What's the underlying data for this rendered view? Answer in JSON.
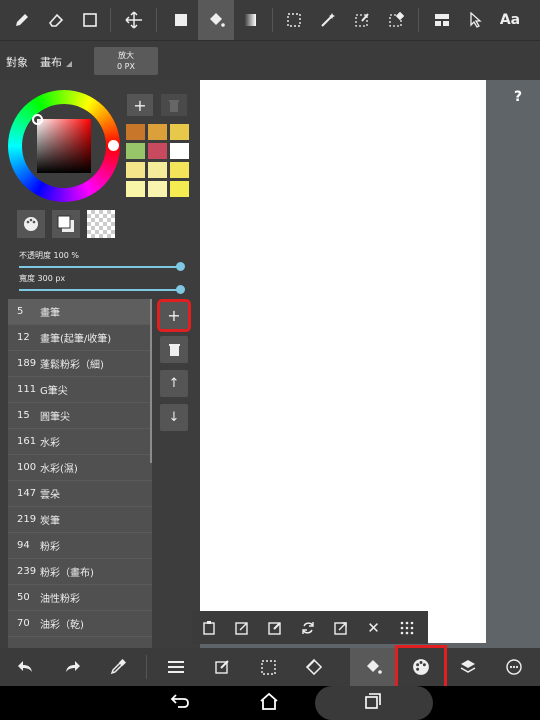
{
  "toolbar_top": {
    "icons": [
      "pen-icon",
      "eraser-icon",
      "rectangle-icon",
      "move-icon",
      "fill-color-icon",
      "bucket-icon",
      "gradient-icon",
      "select-rect-icon",
      "magic-wand-icon",
      "select-pen-icon",
      "select-eraser-icon",
      "layout-icon",
      "pointer-icon"
    ],
    "text_button": "Aa"
  },
  "row2": {
    "target_label": "對象",
    "target_value": "畫布",
    "zoom_label": "放大",
    "zoom_value": "0 PX"
  },
  "color_panel": {
    "add_button": "+",
    "swatches": [
      "#c8762a",
      "#dba03a",
      "#e8c84a",
      "#98c46a",
      "#c84a5e",
      "#ffffff",
      "#f4e48a",
      "#f4ec9a",
      "#f4e45a",
      "#f8f4a8",
      "#f8f4b0",
      "#f4ec50"
    ],
    "opacity_label": "不透明度 100 %",
    "opacity_value": 1.0,
    "width_label": "寬度 300 px",
    "width_value": 1.0
  },
  "brushes": [
    {
      "num": "5",
      "name": "畫筆"
    },
    {
      "num": "12",
      "name": "畫筆(起筆/收筆)"
    },
    {
      "num": "189",
      "name": "蓬鬆粉彩（細)"
    },
    {
      "num": "111",
      "name": "G筆尖"
    },
    {
      "num": "15",
      "name": "圓筆尖"
    },
    {
      "num": "161",
      "name": "水彩"
    },
    {
      "num": "100",
      "name": "水彩(濕)"
    },
    {
      "num": "147",
      "name": "雲朵"
    },
    {
      "num": "219",
      "name": "炭筆"
    },
    {
      "num": "94",
      "name": "粉彩"
    },
    {
      "num": "239",
      "name": "粉彩（畫布)"
    },
    {
      "num": "50",
      "name": "油性粉彩"
    },
    {
      "num": "70",
      "name": "油彩（乾)"
    }
  ],
  "brush_side_buttons": {
    "add": "+",
    "up": "↑",
    "down": "↓"
  },
  "help": "?",
  "floatbar_icons": [
    "paste-icon",
    "import-icon",
    "edit-icon",
    "rotate-icon",
    "open-external-icon",
    "close-icon",
    "grid-dots-icon"
  ],
  "bottom_icons": [
    "undo-icon",
    "redo-icon",
    "eyedropper-icon",
    "menu-icon",
    "edit-square-icon",
    "select-icon",
    "transform-icon",
    "bucket-icon",
    "palette-icon",
    "layers-icon",
    "settings-icon"
  ]
}
